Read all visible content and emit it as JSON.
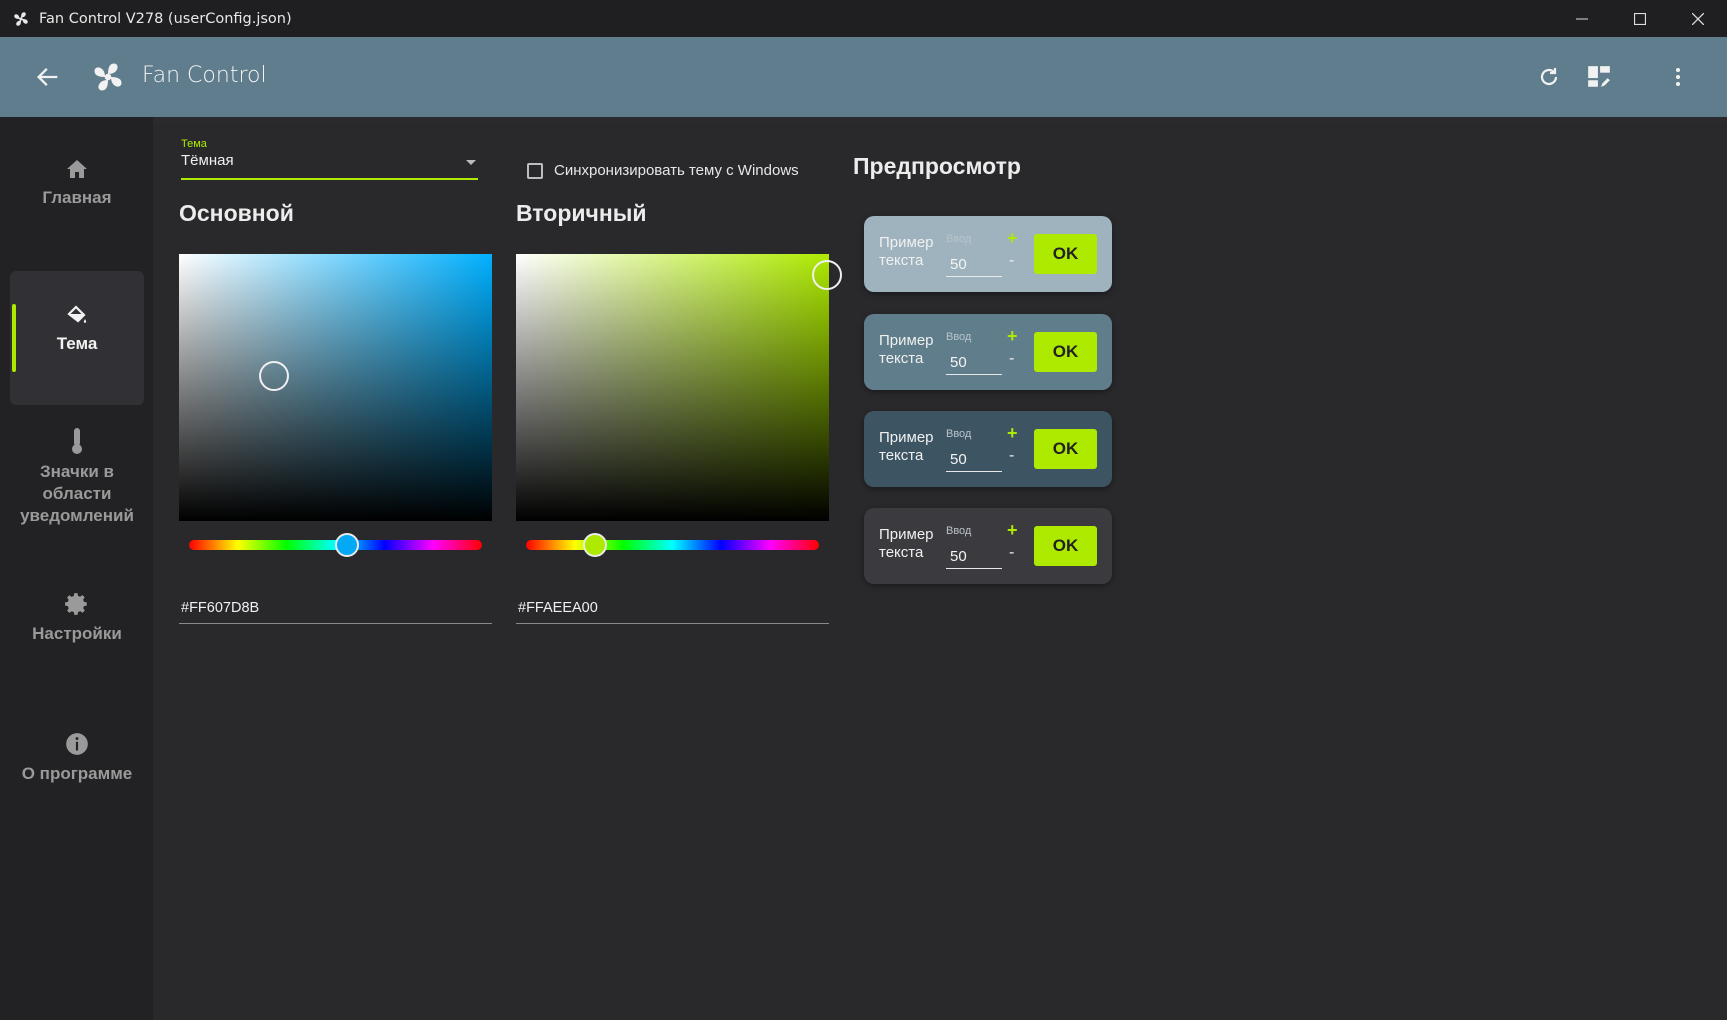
{
  "window": {
    "title": "Fan Control V278 (userConfig.json)"
  },
  "appbar": {
    "title": "Fan Control",
    "actions": [
      "refresh-icon",
      "dashboard-edit-icon",
      "more-vert-icon"
    ]
  },
  "nav": [
    {
      "label": "Главная",
      "icon": "home-icon"
    },
    {
      "label": "Тема",
      "icon": "paint-bucket-icon",
      "active": true
    },
    {
      "label": "Значки в области уведомлений",
      "icon": "thermometer-icon"
    },
    {
      "label": "Настройки",
      "icon": "gear-icon"
    },
    {
      "label": "О программе",
      "icon": "info-icon"
    }
  ],
  "theme": {
    "label": "Тема",
    "value": "Тёмная",
    "sync_label": "Синхронизировать тему с Windows"
  },
  "primary": {
    "title": "Основной",
    "hex": "#FF607D8B",
    "color": "#607d8b"
  },
  "secondary": {
    "title": "Вторичный",
    "hex": "#FFAEEA00",
    "color": "#aeea00"
  },
  "preview": {
    "title": "Предпросмотр",
    "cards": [
      {
        "text": "Пример текста",
        "input_label": "Ввод",
        "input_value": "50",
        "plus": "+",
        "minus": "-",
        "button": "OK",
        "bg": "#9eb3be"
      },
      {
        "text": "Пример текста",
        "input_label": "Ввод",
        "input_value": "50",
        "plus": "+",
        "minus": "-",
        "button": "OK",
        "bg": "#607d8b"
      },
      {
        "text": "Пример текста",
        "input_label": "Ввод",
        "input_value": "50",
        "plus": "+",
        "minus": "-",
        "button": "OK",
        "bg": "#3d5563"
      },
      {
        "text": "Пример текста",
        "input_label": "Ввод",
        "input_value": "50",
        "plus": "+",
        "minus": "-",
        "button": "OK",
        "bg": "#3b3b3f"
      }
    ]
  },
  "colors": {
    "accent": "#aeea00",
    "appbar": "#5f7d8c"
  }
}
